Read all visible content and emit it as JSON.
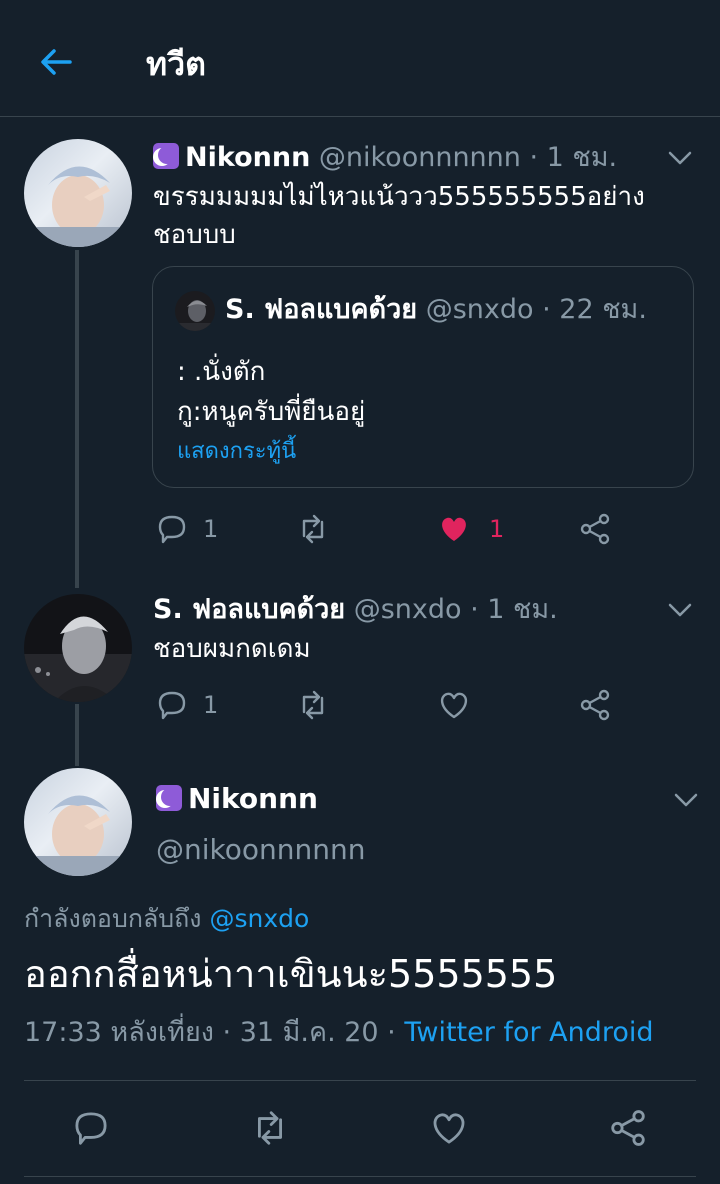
{
  "header": {
    "title": "ทวีต"
  },
  "tweet1": {
    "name": "Nikonnn",
    "meta": "@nikoonnnnnn · 1 ชม.",
    "text_line1": "ขรรมมมมมไม่ไหวแน้ววว555555555อย่าง",
    "text_line2": "ชอบบบ",
    "quote": {
      "name": "S. ฟอลแบคด้วย",
      "meta": "@snxdo · 22 ชม.",
      "line1": ": .นั่งตัก",
      "line2": "กู:หนูครับพี่ยืนอยู่",
      "show_thread": "แสดงกระทู้นี้"
    },
    "reply_count": "1",
    "like_count": "1"
  },
  "tweet2": {
    "name": "S. ฟอลแบคด้วย",
    "meta": "@snxdo · 1 ชม.",
    "text": "ชอบผมกดเดม",
    "reply_count": "1"
  },
  "main_tweet": {
    "name": "Nikonnn",
    "handle": "@nikoonnnnnn",
    "replying_prefix": "กำลังตอบกลับถึง",
    "replying_to": "@snxdo",
    "text": "ออกกสื่อหน่าาาเขินนะ5555555",
    "timestamp": "17:33 หลังเที่ยง · 31 มี.ค. 20 ·",
    "source": "Twitter for Android"
  },
  "colors": {
    "background": "#15202b",
    "accent": "#1da1f2",
    "muted": "#8899a6",
    "like": "#e0245e",
    "divider": "#38444d"
  },
  "icons": [
    "back-arrow-icon",
    "chevron-down-icon",
    "reply-icon",
    "retweet-icon",
    "heart-icon",
    "heart-filled-icon",
    "share-icon",
    "moon-emoji-icon"
  ]
}
